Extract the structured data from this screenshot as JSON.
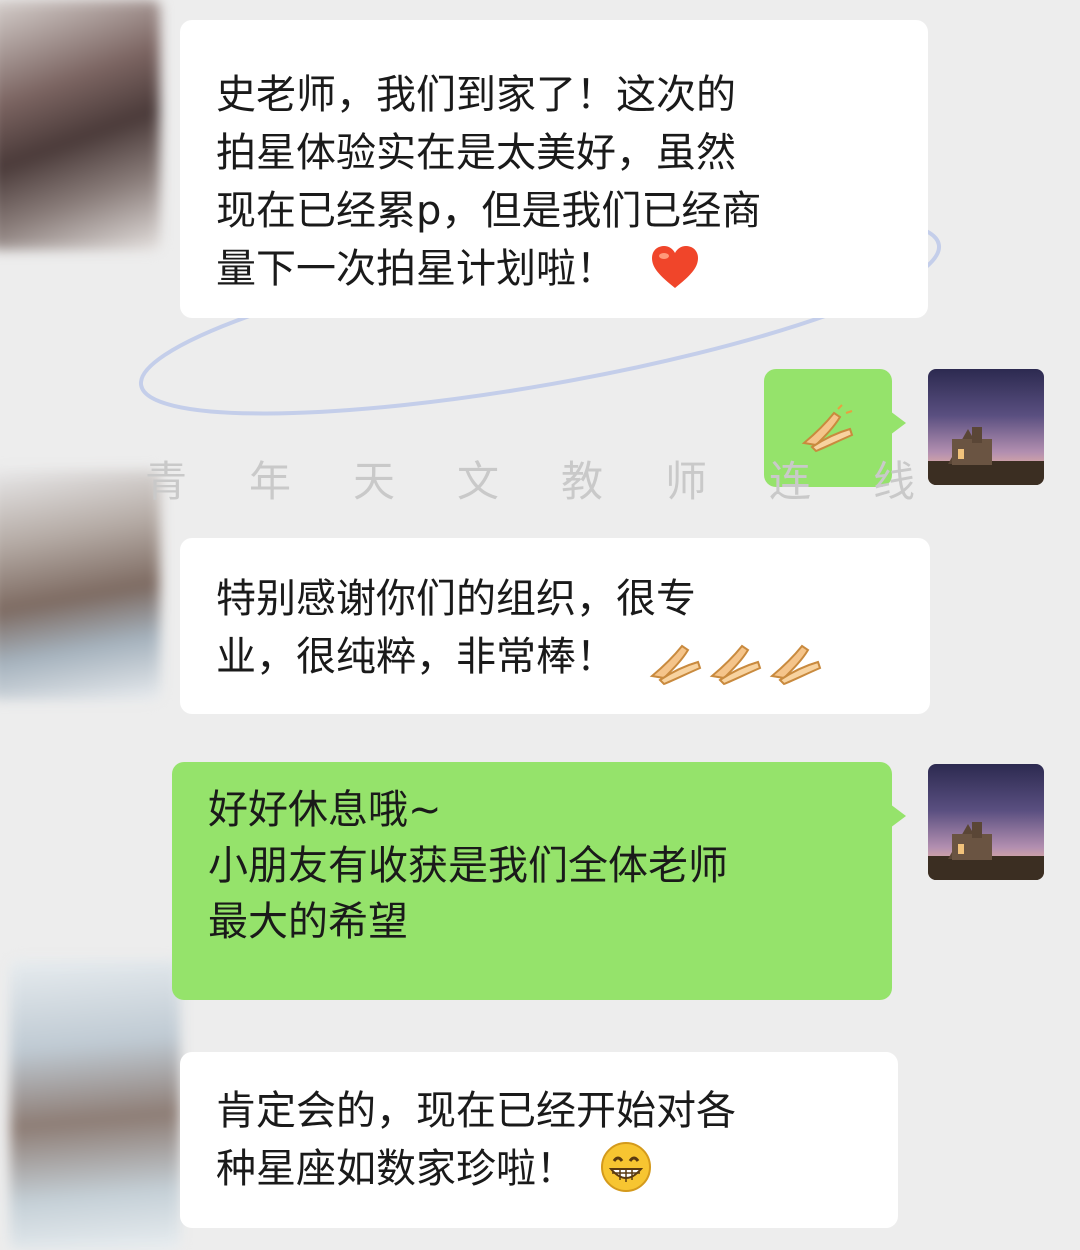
{
  "messages": [
    {
      "side": "left",
      "text": "史老师，我们到家了！这次的\n拍星体验实在是太美好，虽然\n现在已经累p，但是我们已经商\n量下一次拍星计划啦！",
      "emoji": "heart"
    },
    {
      "side": "right",
      "text": "",
      "emoji": "clap"
    },
    {
      "side": "left",
      "text": "特别感谢你们的组织，很专\n业，很纯粹，非常棒！",
      "emoji": "clap-x3"
    },
    {
      "side": "right",
      "text": "好好休息哦~\n小朋友有收获是我们全体老师\n最大的希望"
    },
    {
      "side": "left",
      "text": "肯定会的，现在已经开始对各\n种星座如数家珍啦！",
      "emoji": "grin"
    }
  ],
  "watermark": "青年天文教师连线",
  "colors": {
    "background": "#ededed",
    "incoming": "#ffffff",
    "outgoing": "#95e36b"
  },
  "icons": {
    "heart": "heart-emoji",
    "clap": "clapping-hands-emoji",
    "grin": "grinning-face-emoji"
  }
}
